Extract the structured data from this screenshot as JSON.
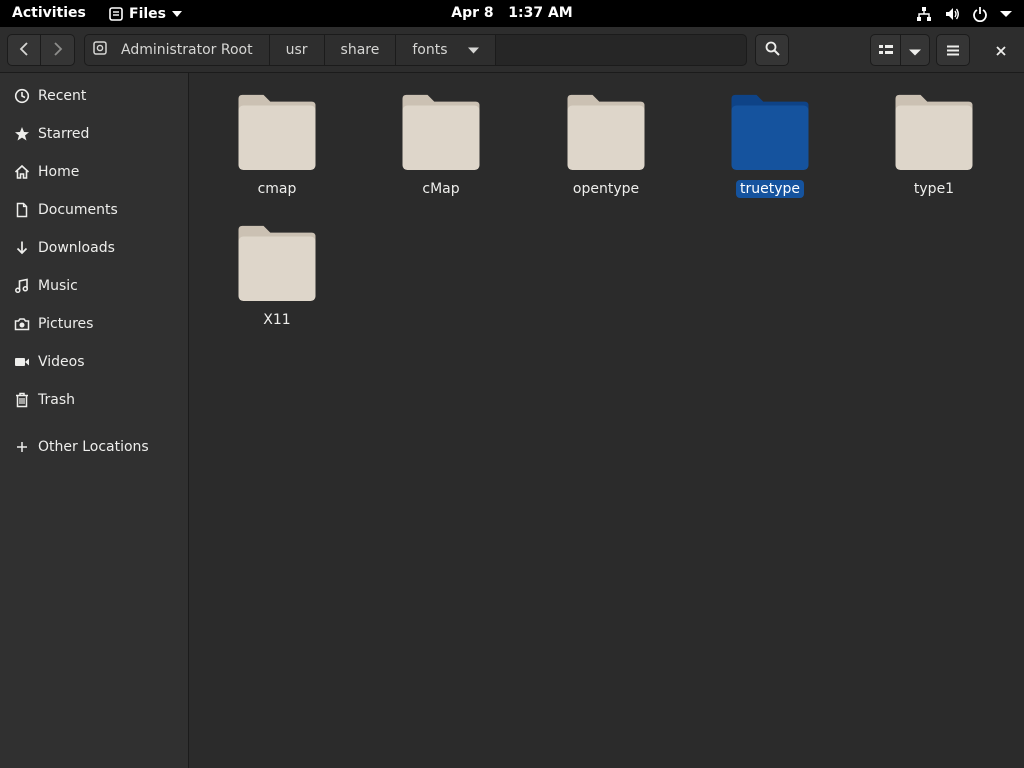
{
  "topbar": {
    "activities": "Activities",
    "app_name": "Files",
    "date": "Apr 8",
    "time": "1:37 AM",
    "icons": [
      "network-icon",
      "volume-icon",
      "power-icon",
      "chevron-down-icon"
    ]
  },
  "header": {
    "path": [
      {
        "label": "Administrator Root",
        "icon": "drive-icon"
      },
      {
        "label": "usr"
      },
      {
        "label": "share"
      },
      {
        "label": "fonts",
        "current": true
      }
    ]
  },
  "sidebar": {
    "items": [
      {
        "label": "Recent",
        "icon": "clock-icon"
      },
      {
        "label": "Starred",
        "icon": "star-icon"
      },
      {
        "label": "Home",
        "icon": "home-icon"
      },
      {
        "label": "Documents",
        "icon": "document-icon"
      },
      {
        "label": "Downloads",
        "icon": "download-icon"
      },
      {
        "label": "Music",
        "icon": "music-icon"
      },
      {
        "label": "Pictures",
        "icon": "camera-icon"
      },
      {
        "label": "Videos",
        "icon": "video-icon"
      },
      {
        "label": "Trash",
        "icon": "trash-icon"
      }
    ],
    "other_locations": {
      "label": "Other Locations",
      "icon": "plus-icon"
    }
  },
  "files": [
    {
      "name": "cmap",
      "selected": false
    },
    {
      "name": "cMap",
      "selected": false
    },
    {
      "name": "opentype",
      "selected": false
    },
    {
      "name": "truetype",
      "selected": true
    },
    {
      "name": "type1",
      "selected": false
    },
    {
      "name": "X11",
      "selected": false
    }
  ],
  "colors": {
    "folder": "#ded6ca",
    "folder_tab": "#cbc1b3",
    "selected_folder": "#15539e",
    "selected_folder_tab": "#0e4387",
    "accent": "#15539e"
  }
}
